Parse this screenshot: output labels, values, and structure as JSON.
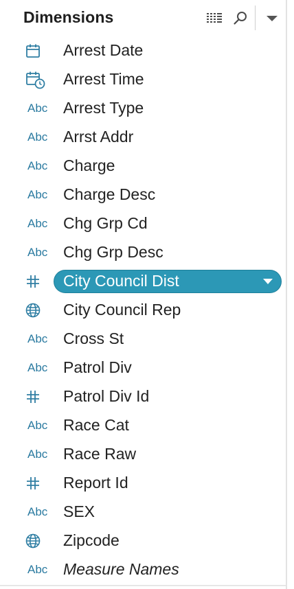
{
  "header": {
    "title": "Dimensions",
    "view_toggle_icon": "list-view-icon",
    "search_icon": "search-icon",
    "menu_icon": "caret-down-icon"
  },
  "colors": {
    "accent": "#2c98b6",
    "icon": "#2f7ea3",
    "text": "#222222"
  },
  "fields": [
    {
      "label": "Arrest Date",
      "type": "date",
      "icon": "calendar-icon"
    },
    {
      "label": "Arrest Time",
      "type": "datetime",
      "icon": "calendar-clock-icon"
    },
    {
      "label": "Arrest Type",
      "type": "string",
      "icon": "Abc"
    },
    {
      "label": "Arrst Addr",
      "type": "string",
      "icon": "Abc"
    },
    {
      "label": "Charge",
      "type": "string",
      "icon": "Abc"
    },
    {
      "label": "Charge Desc",
      "type": "string",
      "icon": "Abc"
    },
    {
      "label": "Chg Grp Cd",
      "type": "string",
      "icon": "Abc"
    },
    {
      "label": "Chg Grp Desc",
      "type": "string",
      "icon": "Abc"
    },
    {
      "label": "City Council Dist",
      "type": "number",
      "icon": "hash-icon",
      "selected": true
    },
    {
      "label": "City Council Rep",
      "type": "geo",
      "icon": "globe-icon"
    },
    {
      "label": "Cross St",
      "type": "string",
      "icon": "Abc"
    },
    {
      "label": "Patrol Div",
      "type": "string",
      "icon": "Abc"
    },
    {
      "label": "Patrol Div Id",
      "type": "number",
      "icon": "hash-icon"
    },
    {
      "label": "Race Cat",
      "type": "string",
      "icon": "Abc"
    },
    {
      "label": "Race Raw",
      "type": "string",
      "icon": "Abc"
    },
    {
      "label": "Report Id",
      "type": "number",
      "icon": "hash-icon"
    },
    {
      "label": "SEX",
      "type": "string",
      "icon": "Abc"
    },
    {
      "label": "Zipcode",
      "type": "geo",
      "icon": "globe-icon"
    },
    {
      "label": "Measure Names",
      "type": "string",
      "icon": "Abc",
      "italic": true
    }
  ]
}
